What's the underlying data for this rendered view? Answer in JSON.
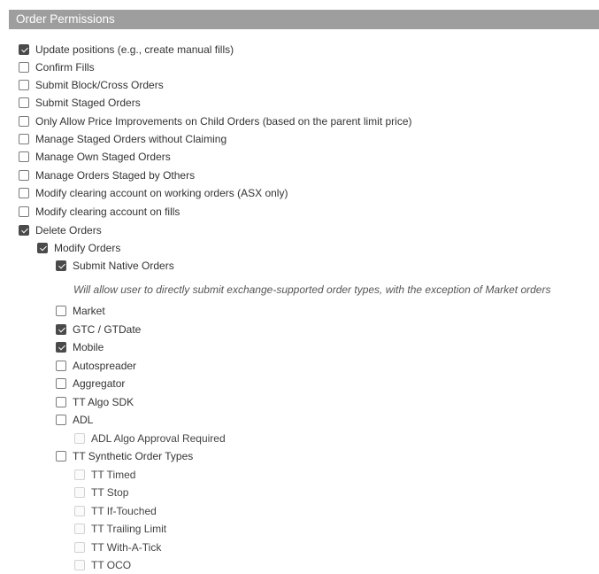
{
  "header": {
    "title": "Order Permissions"
  },
  "permissions": [
    {
      "label": "Update positions (e.g., create manual fills)",
      "checked": true,
      "disabled": false
    },
    {
      "label": "Confirm Fills",
      "checked": false,
      "disabled": false
    },
    {
      "label": "Submit Block/Cross Orders",
      "checked": false,
      "disabled": false
    },
    {
      "label": "Submit Staged Orders",
      "checked": false,
      "disabled": false
    },
    {
      "label": "Only Allow Price Improvements on Child Orders (based on the parent limit price)",
      "checked": false,
      "disabled": false
    },
    {
      "label": "Manage Staged Orders without Claiming",
      "checked": false,
      "disabled": false
    },
    {
      "label": "Manage Own Staged Orders",
      "checked": false,
      "disabled": false
    },
    {
      "label": "Manage Orders Staged by Others",
      "checked": false,
      "disabled": false
    },
    {
      "label": "Modify clearing account on working orders (ASX only)",
      "checked": false,
      "disabled": false
    },
    {
      "label": "Modify clearing account on fills",
      "checked": false,
      "disabled": false
    },
    {
      "label": "Delete Orders",
      "checked": true,
      "disabled": false
    },
    {
      "label": "Modify Orders",
      "checked": true,
      "disabled": false
    },
    {
      "label": "Submit Native Orders",
      "checked": true,
      "disabled": false
    },
    {
      "label": "Market",
      "checked": false,
      "disabled": false
    },
    {
      "label": "GTC / GTDate",
      "checked": true,
      "disabled": false
    },
    {
      "label": "Mobile",
      "checked": true,
      "disabled": false
    },
    {
      "label": "Autospreader",
      "checked": false,
      "disabled": false
    },
    {
      "label": "Aggregator",
      "checked": false,
      "disabled": false
    },
    {
      "label": "TT Algo SDK",
      "checked": false,
      "disabled": false
    },
    {
      "label": "ADL",
      "checked": false,
      "disabled": false
    },
    {
      "label": "ADL Algo Approval Required",
      "checked": false,
      "disabled": true
    },
    {
      "label": "TT Synthetic Order Types",
      "checked": false,
      "disabled": false
    },
    {
      "label": "TT Timed",
      "checked": false,
      "disabled": true
    },
    {
      "label": "TT Stop",
      "checked": false,
      "disabled": true
    },
    {
      "label": "TT If-Touched",
      "checked": false,
      "disabled": true
    },
    {
      "label": "TT Trailing Limit",
      "checked": false,
      "disabled": true
    },
    {
      "label": "TT With-A-Tick",
      "checked": false,
      "disabled": true
    },
    {
      "label": "TT OCO",
      "checked": false,
      "disabled": true
    }
  ],
  "native_orders_note": "Will allow user to directly submit exchange-supported order types, with the exception of Market orders"
}
